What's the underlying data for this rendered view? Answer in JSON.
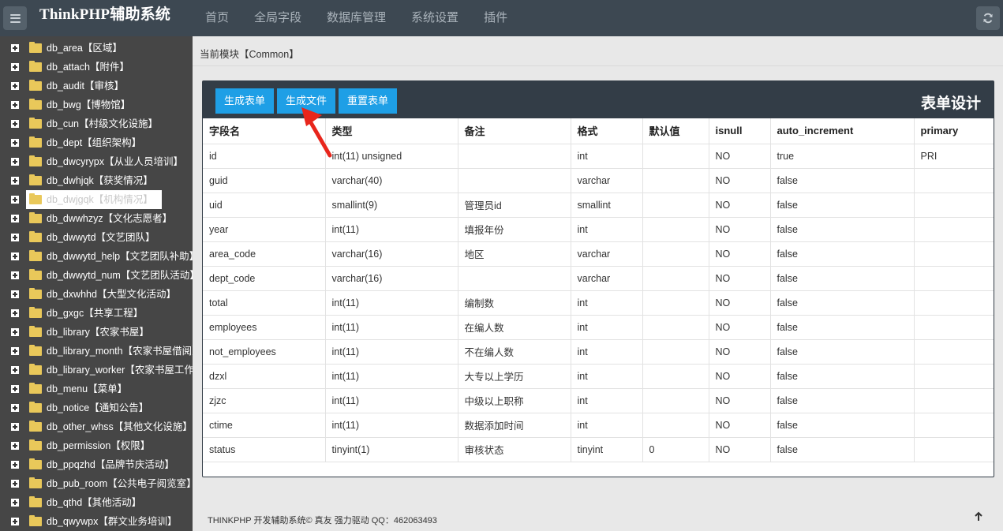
{
  "header": {
    "brand": "ThinkPHP辅助系统",
    "nav": [
      "首页",
      "全局字段",
      "数据库管理",
      "系统设置",
      "插件"
    ]
  },
  "sidebar": {
    "items": [
      "db_area【区域】",
      "db_attach【附件】",
      "db_audit【审核】",
      "db_bwg【博物馆】",
      "db_cun【村级文化设施】",
      "db_dept【组织架构】",
      "db_dwcyrypx【从业人员培训】",
      "db_dwhjqk【获奖情况】",
      "db_dwjgqk【机构情况】",
      "db_dwwhzyz【文化志愿者】",
      "db_dwwytd【文艺团队】",
      "db_dwwytd_help【文艺团队补助】",
      "db_dwwytd_num【文艺团队活动】",
      "db_dxwhhd【大型文化活动】",
      "db_gxgc【共享工程】",
      "db_library【农家书屋】",
      "db_library_month【农家书屋借阅】",
      "db_library_worker【农家书屋工作】",
      "db_menu【菜单】",
      "db_notice【通知公告】",
      "db_other_whss【其他文化设施】",
      "db_permission【权限】",
      "db_ppqzhd【品牌节庆活动】",
      "db_pub_room【公共电子阅览室】",
      "db_qthd【其他活动】",
      "db_qwywpx【群文业务培训】"
    ],
    "selected_index": 8
  },
  "breadcrumb": "当前模块【Common】",
  "panel": {
    "title": "表单设计",
    "buttons": [
      "生成表单",
      "生成文件",
      "重置表单"
    ]
  },
  "table": {
    "columns": [
      "字段名",
      "类型",
      "备注",
      "格式",
      "默认值",
      "isnull",
      "auto_increment",
      "primary"
    ],
    "rows": [
      [
        "id",
        "int(11) unsigned",
        "",
        "int",
        "",
        "NO",
        "true",
        "PRI"
      ],
      [
        "guid",
        "varchar(40)",
        "",
        "varchar",
        "",
        "NO",
        "false",
        ""
      ],
      [
        "uid",
        "smallint(9)",
        "管理员id",
        "smallint",
        "",
        "NO",
        "false",
        ""
      ],
      [
        "year",
        "int(11)",
        "填报年份",
        "int",
        "",
        "NO",
        "false",
        ""
      ],
      [
        "area_code",
        "varchar(16)",
        "地区",
        "varchar",
        "",
        "NO",
        "false",
        ""
      ],
      [
        "dept_code",
        "varchar(16)",
        "",
        "varchar",
        "",
        "NO",
        "false",
        ""
      ],
      [
        "total",
        "int(11)",
        "编制数",
        "int",
        "",
        "NO",
        "false",
        ""
      ],
      [
        "employees",
        "int(11)",
        "在编人数",
        "int",
        "",
        "NO",
        "false",
        ""
      ],
      [
        "not_employees",
        "int(11)",
        "不在编人数",
        "int",
        "",
        "NO",
        "false",
        ""
      ],
      [
        "dzxl",
        "int(11)",
        "大专以上学历",
        "int",
        "",
        "NO",
        "false",
        ""
      ],
      [
        "zjzc",
        "int(11)",
        "中级以上职称",
        "int",
        "",
        "NO",
        "false",
        ""
      ],
      [
        "ctime",
        "int(11)",
        "数据添加时间",
        "int",
        "",
        "NO",
        "false",
        ""
      ],
      [
        "status",
        "tinyint(1)",
        "审核状态",
        "tinyint",
        "0",
        "NO",
        "false",
        ""
      ]
    ]
  },
  "footer": "THINKPHP 开发辅助系统© 真友 强力驱动 QQ：462063493",
  "colors": {
    "topbar": "#3d4852",
    "sidebar": "#464646",
    "button": "#1e9fe6",
    "panel_head": "#333d47",
    "annotation_arrow": "#e8261c"
  }
}
